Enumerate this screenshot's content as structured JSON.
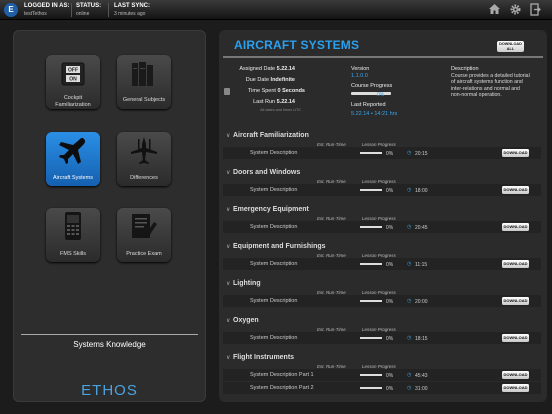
{
  "topbar": {
    "logo_glyph": "E",
    "logged_in_label": "LOGGED IN AS:",
    "logged_in_value": "testTethos",
    "status_label": "STATUS:",
    "status_value": "online",
    "sync_label": "LAST SYNC:",
    "sync_value": "3 minutes ago",
    "icons": [
      "home-icon",
      "gear-icon",
      "logout-icon"
    ]
  },
  "left": {
    "tiles": [
      {
        "label": "Cockpit Familiarization",
        "label_lines": [
          "Cockpit",
          "Familiarization"
        ],
        "icon": "cockpit-icon",
        "active": false
      },
      {
        "label": "General Subjects",
        "label_lines": [
          "General Subjects"
        ],
        "icon": "books-icon",
        "active": false
      },
      {
        "label": "Aircraft Systems",
        "label_lines": [
          "Aircraft Systems"
        ],
        "icon": "airplane-icon",
        "active": true
      },
      {
        "label": "Differences",
        "label_lines": [
          "Differences"
        ],
        "icon": "differences-icon",
        "active": false
      },
      {
        "label": "FMS Skills",
        "label_lines": [
          "FMS Skills"
        ],
        "icon": "fms-icon",
        "active": false
      },
      {
        "label": "Practice Exam",
        "label_lines": [
          "Practice Exam"
        ],
        "icon": "exam-icon",
        "active": false
      }
    ],
    "section_title": "Systems Knowledge",
    "brand": "ETHOS"
  },
  "main": {
    "title": "AIRCRAFT SYSTEMS",
    "download_all_label_1": "DOWNLOAD",
    "download_all_label_2": "ALL",
    "assigned_label": "Assigned Date",
    "assigned_value": "5.22.14",
    "due_label": "Due Date",
    "due_value": "Indefinite",
    "time_spent_label": "Time Spent",
    "time_spent_value": "0 Seconds",
    "last_run_label": "Last Run",
    "last_run_value": "5.22.14",
    "tz_note": "All dates and times UTC",
    "version_label": "Version",
    "version_value": "1.1.0.0",
    "course_progress_label": "Course Progress",
    "course_progress_value": "0%",
    "course_progress_fraction": 0,
    "last_reported_label": "Last Reported",
    "last_reported_value": "5.22.14  •  14:21 hrs",
    "description_label": "Description",
    "description_text": "Course provides a detailed tutorial of aircraft systems function and inter-relations and normal and non-normal operation.",
    "col_runtime": "Est. Run-Time",
    "col_progress": "Lesson Progress",
    "download_label": "DOWNLOAD",
    "sections": [
      {
        "title": "Aircraft Familiarization",
        "lessons": [
          {
            "name": "System Description",
            "pct": "0%",
            "time": "20:15"
          }
        ]
      },
      {
        "title": "Doors and Windows",
        "lessons": [
          {
            "name": "System Description",
            "pct": "0%",
            "time": "18:00"
          }
        ]
      },
      {
        "title": "Emergency Equipment",
        "lessons": [
          {
            "name": "System Description",
            "pct": "0%",
            "time": "20:45"
          }
        ]
      },
      {
        "title": "Equipment and Furnishings",
        "lessons": [
          {
            "name": "System Description",
            "pct": "0%",
            "time": "11:15"
          }
        ]
      },
      {
        "title": "Lighting",
        "lessons": [
          {
            "name": "System Description",
            "pct": "0%",
            "time": "20:00"
          }
        ]
      },
      {
        "title": "Oxygen",
        "lessons": [
          {
            "name": "System Description",
            "pct": "0%",
            "time": "18:15"
          }
        ]
      },
      {
        "title": "Flight Instruments",
        "lessons": [
          {
            "name": "System Description Part 1",
            "pct": "0%",
            "time": "45:43"
          },
          {
            "name": "System Description Part 2",
            "pct": "0%",
            "time": "31:00"
          }
        ]
      }
    ]
  }
}
